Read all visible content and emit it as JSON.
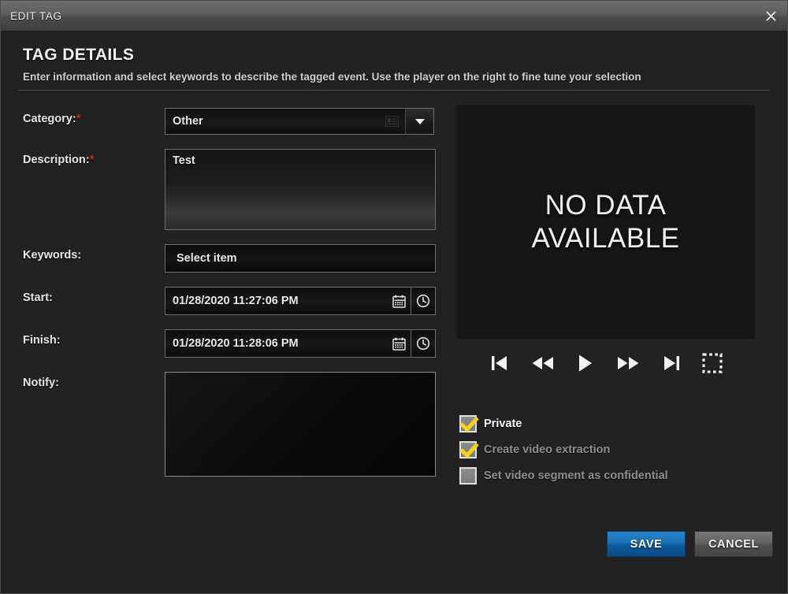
{
  "window": {
    "title": "EDIT TAG",
    "close_icon": "close-icon"
  },
  "header": {
    "title": "TAG DETAILS",
    "subtitle": "Enter information and select keywords to describe the tagged event. Use the player on the right to fine tune your selection"
  },
  "form": {
    "category": {
      "label": "Category:",
      "required_marker": "*",
      "value": "Other",
      "dropdown_icon": "chevron-down-icon"
    },
    "description": {
      "label": "Description:",
      "required_marker": "*",
      "value": "Test"
    },
    "keywords": {
      "label": "Keywords:",
      "value": "Select item"
    },
    "start": {
      "label": "Start:",
      "value": "01/28/2020 11:27:06 PM",
      "calendar_icon": "calendar-icon",
      "clock_icon": "clock-icon"
    },
    "finish": {
      "label": "Finish:",
      "value": "01/28/2020 11:28:06 PM",
      "calendar_icon": "calendar-icon",
      "clock_icon": "clock-icon"
    },
    "notify": {
      "label": "Notify:",
      "value": ""
    }
  },
  "player": {
    "no_data_line1": "NO DATA",
    "no_data_line2": "AVAILABLE",
    "controls": [
      {
        "name": "skip-to-start-button",
        "icon": "skip-to-start-icon"
      },
      {
        "name": "rewind-button",
        "icon": "rewind-icon"
      },
      {
        "name": "play-button",
        "icon": "play-icon"
      },
      {
        "name": "fast-forward-button",
        "icon": "fast-forward-icon"
      },
      {
        "name": "skip-to-end-button",
        "icon": "skip-to-end-icon"
      },
      {
        "name": "select-region-button",
        "icon": "dashed-square-icon"
      }
    ]
  },
  "checkboxes": [
    {
      "label": "Private",
      "checked": true,
      "enabled": true
    },
    {
      "label": "Create video extraction",
      "checked": true,
      "enabled": false
    },
    {
      "label": "Set video segment as confidential",
      "checked": false,
      "enabled": false
    }
  ],
  "footer": {
    "save_label": "SAVE",
    "cancel_label": "CANCEL"
  },
  "colors": {
    "accent_save": "#1971b4",
    "required_marker": "#e02222",
    "checkmark": "#f2d21a",
    "dialog_background": "#222222",
    "titlebar": "#5d5d5d"
  }
}
